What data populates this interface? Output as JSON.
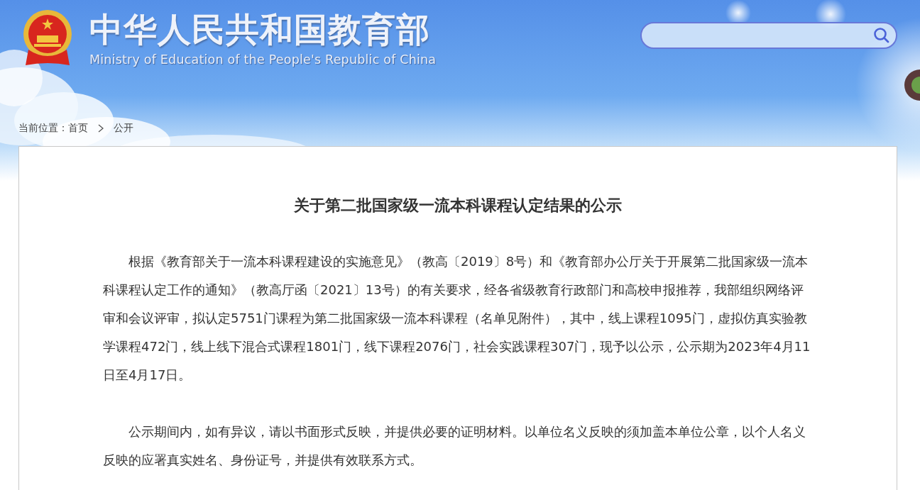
{
  "header": {
    "title": "中华人民共和国教育部",
    "subtitle": "Ministry of Education of the People's Republic of China"
  },
  "breadcrumb": {
    "label": "当前位置：",
    "items": [
      "首页",
      "公开"
    ]
  },
  "article": {
    "title": "关于第二批国家级一流本科课程认定结果的公示",
    "paragraphs": [
      "根据《教育部关于一流本科课程建设的实施意见》（教高〔2019〕8号）和《教育部办公厅关于开展第二批国家级一流本科课程认定工作的通知》（教高厅函〔2021〕13号）的有关要求，经各省级教育行政部门和高校申报推荐，我部组织网络评审和会议评审，拟认定5751门课程为第二批国家级一流本科课程（名单见附件），其中，线上课程1095门，虚拟仿真实验教学课程472门，线上线下混合式课程1801门，线下课程2076门，社会实践课程307门，现予以公示，公示期为2023年4月11日至4月17日。",
      "公示期间内，如有异议，请以书面形式反映，并提供必要的证明材料。以单位名义反映的须加盖本单位公章，以个人名义反映的应署真实姓名、身份证号，并提供有效联系方式。"
    ]
  }
}
